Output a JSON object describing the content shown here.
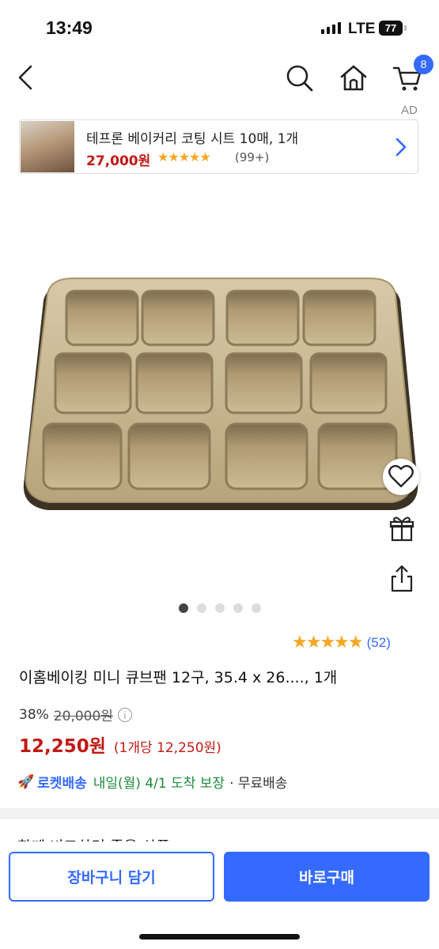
{
  "status_bar": {
    "time": "13:49",
    "network": "LTE",
    "battery": "77"
  },
  "nav": {
    "cart_badge": "8"
  },
  "ad": {
    "label": "AD",
    "title": "테프론 베이커리 코팅 시트 10매, 1개",
    "price": "27,000원",
    "stars": "★★★★★",
    "review_count": "(99+)"
  },
  "carousel": {
    "total": 5,
    "active": 1
  },
  "product": {
    "rating_stars": "★★★★★",
    "rating_value": 4.5,
    "review_count": "(52)",
    "title": "이홈베이킹 미니 큐브팬 12구, 35.4 x 26...., 1개",
    "discount": "38%",
    "original_price": "20,000원",
    "info_icon": "i",
    "price": "12,250원",
    "unit_price": "(1개당 12,250원)"
  },
  "delivery": {
    "rocket_icon": "🚀",
    "label": "로켓배송",
    "arrival": "내일(월) 4/1 도착 보장",
    "fee": "· 무료배송"
  },
  "section_partial": "함께 비교하면 좋을 상품",
  "buttons": {
    "add_to_cart": "장바구니 담기",
    "buy_now": "바로구매"
  },
  "colors": {
    "accent": "#346aff",
    "price": "#c01a15",
    "star": "#f5a623",
    "delivery_green": "#1b8a3a"
  }
}
